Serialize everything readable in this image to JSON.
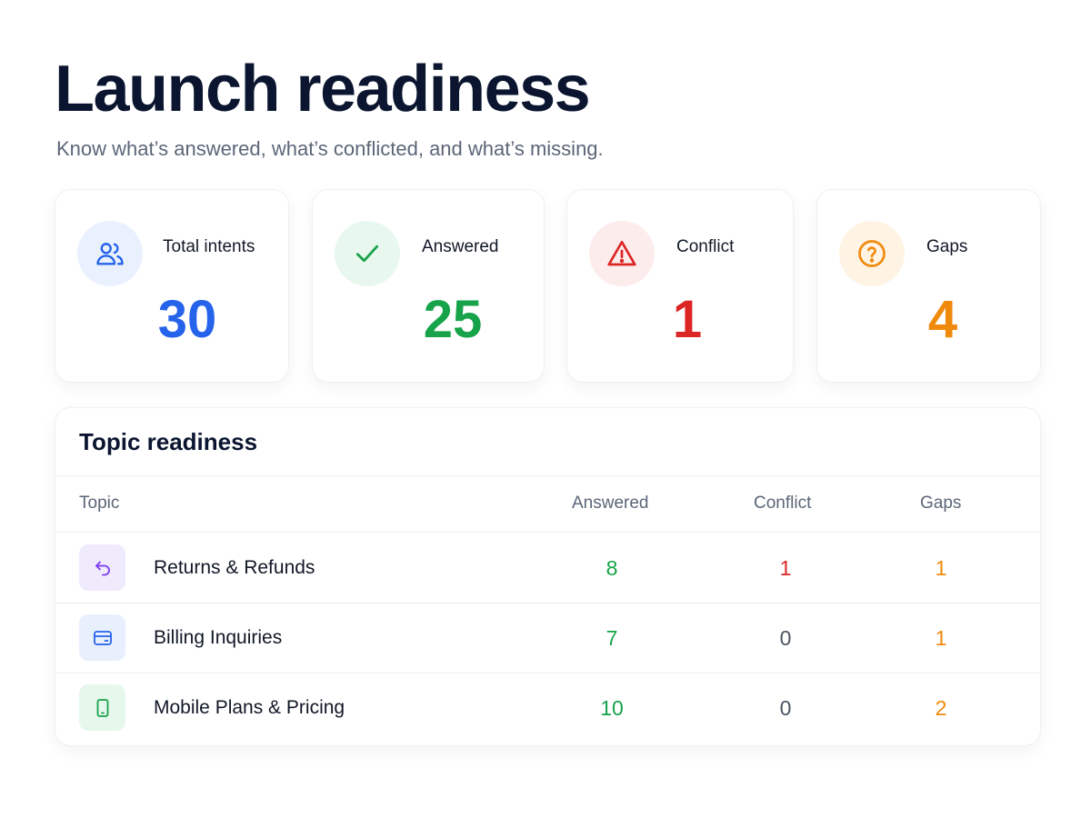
{
  "header": {
    "title": "Launch readiness",
    "subtitle": "Know what’s answered, what’s conflicted, and what’s missing."
  },
  "stats": [
    {
      "label": "Total intents",
      "value": "30",
      "icon": "users-icon",
      "color": "#2563eb",
      "badge_bg": "#eaf1fe"
    },
    {
      "label": "Answered",
      "value": "25",
      "icon": "check-icon",
      "color": "#16a34a",
      "badge_bg": "#e9f8ef"
    },
    {
      "label": "Conflict",
      "value": "1",
      "icon": "warning-icon",
      "color": "#dc2626",
      "badge_bg": "#fdecec"
    },
    {
      "label": "Gaps",
      "value": "4",
      "icon": "question-circle-icon",
      "color": "#f08a0c",
      "badge_bg": "#fff3e4"
    }
  ],
  "topic_readiness": {
    "title": "Topic readiness",
    "columns": {
      "topic": "Topic",
      "answered": "Answered",
      "conflict": "Conflict",
      "gaps": "Gaps"
    },
    "rows": [
      {
        "topic": "Returns & Refunds",
        "icon": "return-arrow-icon",
        "answered": "8",
        "conflict": "1",
        "gaps": "1"
      },
      {
        "topic": "Billing Inquiries",
        "icon": "credit-card-icon",
        "answered": "7",
        "conflict": "0",
        "gaps": "1"
      },
      {
        "topic": "Mobile Plans & Pricing",
        "icon": "mobile-phone-icon",
        "answered": "10",
        "conflict": "0",
        "gaps": "2"
      }
    ]
  },
  "colors": {
    "answered": "#16a34a",
    "conflict": "#dc2626",
    "gaps": "#f08a0c",
    "neutral": "#4b5563"
  }
}
